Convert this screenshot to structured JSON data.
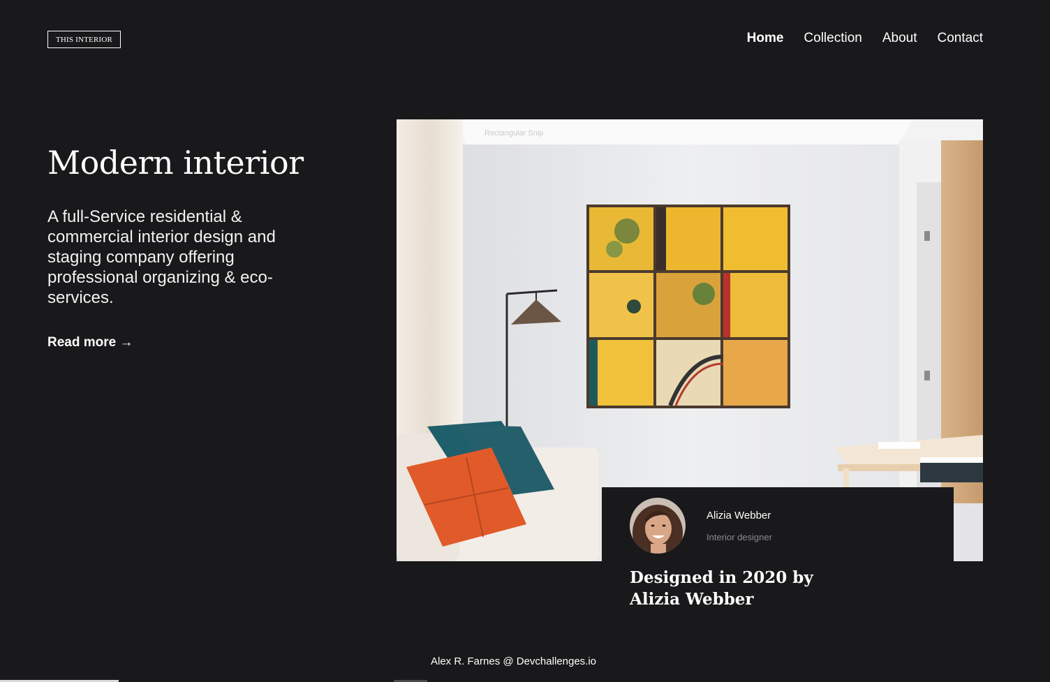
{
  "header": {
    "logo": "THIS INTERIOR",
    "nav": [
      {
        "label": "Home",
        "active": true
      },
      {
        "label": "Collection",
        "active": false
      },
      {
        "label": "About",
        "active": false
      },
      {
        "label": "Contact",
        "active": false
      }
    ]
  },
  "hero": {
    "title": "Modern interior",
    "description": "A full-Service residential & commercial interior design and staging company offering professional organizing & eco-services.",
    "read_more": "Read more →",
    "image_overlay_text": "Rectangular Snip"
  },
  "designer": {
    "name": "Alizia Webber",
    "role": "Interior designer",
    "caption": "Designed in 2020 by Alizia Webber"
  },
  "footer": {
    "credit": "Alex R. Farnes @ Devchallenges.io"
  },
  "colors": {
    "background": "#19191b",
    "text": "#ffffff",
    "muted": "#8b8b8f"
  }
}
